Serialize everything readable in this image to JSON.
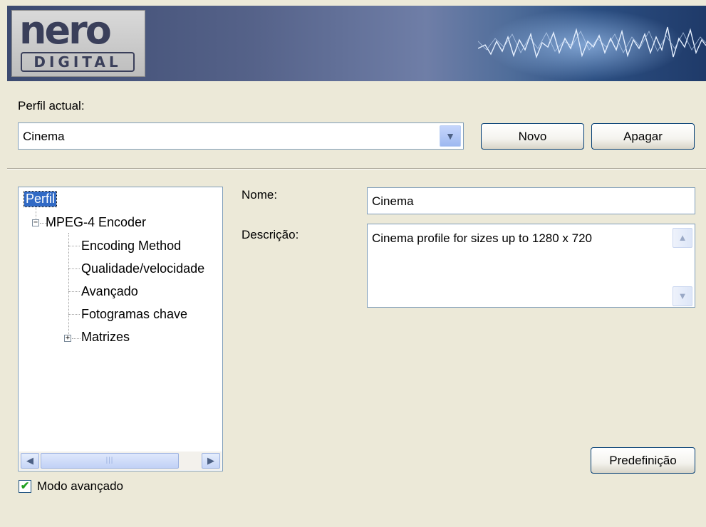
{
  "logo": {
    "word": "nero",
    "sub": "DIGITAL"
  },
  "profile": {
    "label": "Perfil actual:",
    "selected": "Cinema",
    "new_label": "Novo",
    "delete_label": "Apagar"
  },
  "tree": {
    "root": "Perfil",
    "encoder": "MPEG-4 Encoder",
    "children": [
      "Encoding Method",
      "Qualidade/velocidade",
      "Avançado",
      "Fotogramas chave"
    ],
    "matrices": "Matrizes"
  },
  "form": {
    "name_label": "Nome:",
    "name_value": "Cinema",
    "desc_label": "Descrição:",
    "desc_value": "Cinema profile for sizes up to 1280 x 720",
    "default_label": "Predefinição"
  },
  "advanced": {
    "label": "Modo avançado",
    "checked": true
  },
  "icons": {
    "dropdown": "chevron-down-icon",
    "expand": "plus-box-icon",
    "collapse": "minus-box-icon",
    "scroll_left": "arrow-left-icon",
    "scroll_right": "arrow-right-icon",
    "scroll_up": "arrow-up-icon",
    "scroll_down": "arrow-down-icon",
    "check": "checkmark-icon"
  }
}
